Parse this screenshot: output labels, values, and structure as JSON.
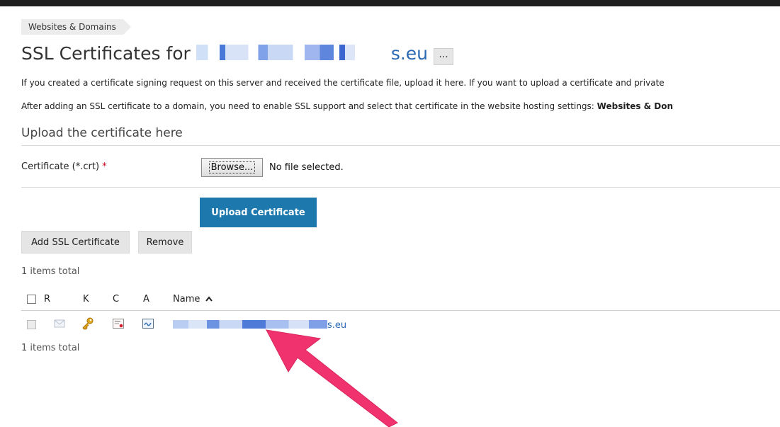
{
  "breadcrumb": {
    "label": "Websites & Domains"
  },
  "header": {
    "title_prefix": "SSL Certificates for",
    "domain_suffix": "s.eu",
    "more_label": "..."
  },
  "info": {
    "line1": "If you created a certificate signing request on this server and received the certificate file, upload it here. If you want to upload a certificate and private",
    "line2_prefix": "After adding an SSL certificate to a domain, you need to enable SSL support and select that certificate in the website hosting settings: ",
    "line2_bold": "Websites & Don"
  },
  "upload": {
    "section_title": "Upload the certificate here",
    "field_label": "Certificate (*.crt)",
    "required_mark": "*",
    "browse_label": "Browse...",
    "no_file_text": "No file selected.",
    "submit_label": "Upload Certificate"
  },
  "toolbar": {
    "add_label": "Add SSL Certificate",
    "remove_label": "Remove"
  },
  "list": {
    "count_top": "1 items total",
    "count_bottom": "1 items total",
    "columns": {
      "r": "R",
      "k": "K",
      "c": "C",
      "a": "A",
      "name": "Name"
    },
    "sort_indicator": "^",
    "rows": [
      {
        "name_suffix": "s.eu"
      }
    ]
  },
  "icons": [
    "envelope-icon",
    "key-icon",
    "certificate-icon",
    "ca-certificate-icon",
    "sort-up-icon"
  ],
  "colors": {
    "primary_button": "#1d79ad",
    "link": "#2a6ab3",
    "annotation_arrow": "#f0336f",
    "required": "#d0021b"
  }
}
